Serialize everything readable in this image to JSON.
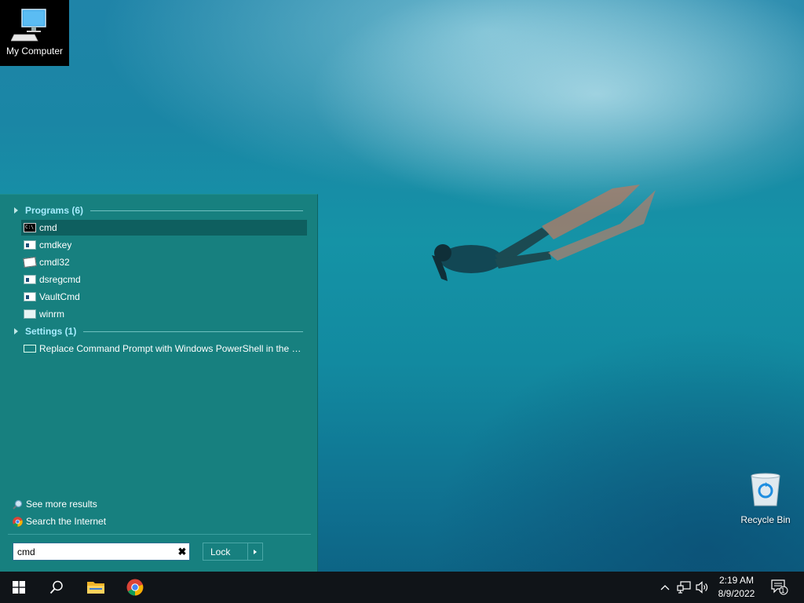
{
  "desktop": {
    "my_computer_label": "My Computer",
    "recycle_bin_label": "Recycle Bin"
  },
  "start_menu": {
    "programs_header": "Programs (6)",
    "programs": [
      {
        "label": "cmd",
        "icon": "command-prompt-icon",
        "selected": true
      },
      {
        "label": "cmdkey",
        "icon": "app-window-icon"
      },
      {
        "label": "cmdl32",
        "icon": "certificate-icon"
      },
      {
        "label": "dsregcmd",
        "icon": "app-window-icon"
      },
      {
        "label": "VaultCmd",
        "icon": "app-window-icon"
      },
      {
        "label": "winrm",
        "icon": "network-app-icon"
      }
    ],
    "settings_header": "Settings (1)",
    "settings": [
      {
        "label": "Replace Command Prompt with Windows PowerShell in the W...",
        "icon": "monitor-icon"
      }
    ],
    "see_more_results": "See more results",
    "search_internet": "Search the Internet",
    "search": {
      "value": "cmd",
      "clear_symbol": "✖"
    },
    "lock_button_label": "Lock"
  },
  "taskbar": {
    "clock_time": "2:19 AM",
    "clock_date": "8/9/2022",
    "notification_count": "1"
  },
  "colors": {
    "panel": "#17807f",
    "selected_item": "#0e5f5f",
    "section_header": "#a7ecff",
    "taskbar": "#101418"
  }
}
